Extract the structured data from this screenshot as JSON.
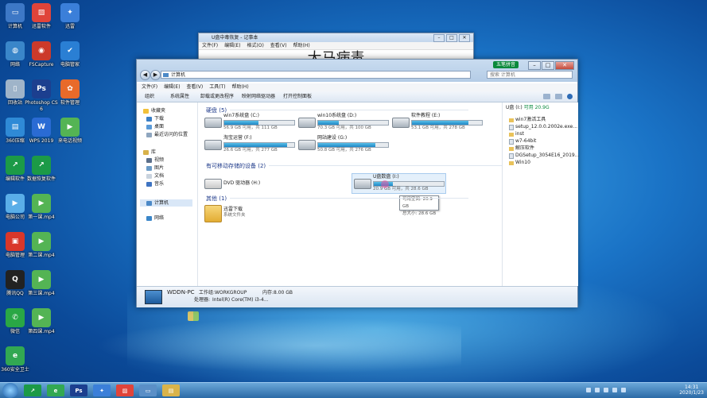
{
  "desktop": {
    "icons": [
      {
        "label": "计算机",
        "color": "#3d78c6",
        "glyph": "▭"
      },
      {
        "label": "网络",
        "color": "#3a86c9",
        "glyph": "◍"
      },
      {
        "label": "回收站",
        "color": "#9fb4c9",
        "glyph": "▯"
      },
      {
        "label": "360压缩",
        "color": "#2f8ad6",
        "glyph": "▤"
      },
      {
        "label": "编辑软件",
        "color": "#1c9a47",
        "glyph": "↗"
      },
      {
        "label": "电脑公司",
        "color": "#5aaee8",
        "glyph": "▶"
      },
      {
        "label": "电脑管理",
        "color": "#d9372a",
        "glyph": "▣"
      },
      {
        "label": "腾讯QQ",
        "color": "#222222",
        "glyph": "Q"
      },
      {
        "label": "微信",
        "color": "#2aa745",
        "glyph": "✆"
      },
      {
        "label": "360安全卫士",
        "color": "#32a852",
        "glyph": "e"
      },
      {
        "label": "迅雷软件",
        "color": "#e0443a",
        "glyph": "▨"
      },
      {
        "label": "FSCapture",
        "color": "#cc3a2a",
        "glyph": "◉"
      },
      {
        "label": "Photoshop CS6",
        "color": "#1c3f8f",
        "glyph": "Ps"
      },
      {
        "label": "WPS 2019",
        "color": "#2a6bd4",
        "glyph": "W"
      },
      {
        "label": "数据恢复软件",
        "color": "#1c9a47",
        "glyph": "↗"
      },
      {
        "label": "第一课.mp4",
        "color": "#54b454",
        "glyph": "▶"
      },
      {
        "label": "第二课.mp4",
        "color": "#54b454",
        "glyph": "▶"
      },
      {
        "label": "第三课.mp4",
        "color": "#54b454",
        "glyph": "▶"
      },
      {
        "label": "第四课.mp4",
        "color": "#54b454",
        "glyph": "▶"
      },
      {
        "label": "迅雷",
        "color": "#3b7fd9",
        "glyph": "✦"
      },
      {
        "label": "电脑管家",
        "color": "#2a7fd4",
        "glyph": "✔"
      },
      {
        "label": "软件管理",
        "color": "#e86a2a",
        "glyph": "✿"
      },
      {
        "label": "来电话视频",
        "color": "#54b454",
        "glyph": "▶"
      }
    ]
  },
  "notepad": {
    "title": "U盘中毒恢复 - 记事本",
    "menu": [
      "文件(F)",
      "编辑(E)",
      "格式(O)",
      "查看(V)",
      "帮助(H)"
    ],
    "text": "大马病毒"
  },
  "explorer": {
    "badge": "五笔拼音",
    "address": "计算机",
    "search_placeholder": "搜索 计算机",
    "menu": [
      "文件(F)",
      "编辑(E)",
      "查看(V)",
      "工具(T)",
      "帮助(H)"
    ],
    "toolbar": [
      "组织",
      "系统属性",
      "卸载或更改程序",
      "映射网络驱动器",
      "打开控制面板"
    ],
    "nav": {
      "favorites": "收藏夹",
      "fav_items": [
        "下载",
        "桌面",
        "最近访问的位置"
      ],
      "libraries": "库",
      "lib_items": [
        "视频",
        "图片",
        "文档",
        "音乐"
      ],
      "computer": "计算机",
      "network": "网络"
    },
    "groups": {
      "hdd": "硬盘 (5)",
      "removable": "有可移动存储的设备 (2)",
      "other": "其他 (1)"
    },
    "drives": [
      {
        "name": "win7系统盘 (C:)",
        "free": "56.9 GB 可用，共 111 GB",
        "fill": 0.49
      },
      {
        "name": "win10系统盘 (D:)",
        "free": "70.3 GB 可用，共 100 GB",
        "fill": 0.3
      },
      {
        "name": "软件教程 (E:)",
        "free": "53.1 GB 可用，共 278 GB",
        "fill": 0.81
      },
      {
        "name": "淘宝运营 (F:)",
        "free": "26.6 GB 可用，共 277 GB",
        "fill": 0.9
      },
      {
        "name": "网站建设 (G:)",
        "free": "50.8 GB 可用，共 276 GB",
        "fill": 0.82
      }
    ],
    "dvd": {
      "name": "DVD 驱动器 (H:)"
    },
    "usb": {
      "name": "U盘数盘 (I:)",
      "free": "20.9 GB 可用，共 28.6 GB",
      "fill": 0.27
    },
    "tooltip": [
      "可用空间: 20.9 GB",
      "总大小: 28.6 GB"
    ],
    "other": {
      "name": "迅雷下载",
      "sub": "系统文件夹"
    },
    "preview": {
      "header": "U盘 (I:)",
      "header_free": "可用 20.9G",
      "items": [
        {
          "name": "win7激活工具",
          "type": "folder"
        },
        {
          "name": "setup_12.0.0.2002e.exe...",
          "type": "file"
        },
        {
          "name": "inst",
          "type": "folder"
        },
        {
          "name": "w7-64bit",
          "type": "file"
        },
        {
          "name": "解压软件",
          "type": "folder"
        },
        {
          "name": "DGSetup_3054E16_2019...",
          "type": "file"
        },
        {
          "name": "Win10",
          "type": "folder"
        }
      ]
    },
    "details": {
      "pc_name": "WDDN-PC",
      "workgroup_label": "工作组:",
      "workgroup": "WORKGROUP",
      "memory_label": "内存:",
      "memory": "8.00 GB",
      "cpu_label": "处理器:",
      "cpu": "Intel(R) Core(TM) i3-4..."
    }
  },
  "taskbar": {
    "buttons": [
      {
        "glyph": "↗",
        "color": "#1c9a47"
      },
      {
        "glyph": "e",
        "color": "#32a852"
      },
      {
        "glyph": "Ps",
        "color": "#1c3f8f"
      },
      {
        "glyph": "✦",
        "color": "#3b7fd9"
      },
      {
        "glyph": "▨",
        "color": "#e0443a"
      },
      {
        "glyph": "▭",
        "color": "#5a8fc7"
      },
      {
        "glyph": "▤",
        "color": "#d9b34a"
      }
    ],
    "time": "14:31",
    "date": "2020/1/23"
  }
}
